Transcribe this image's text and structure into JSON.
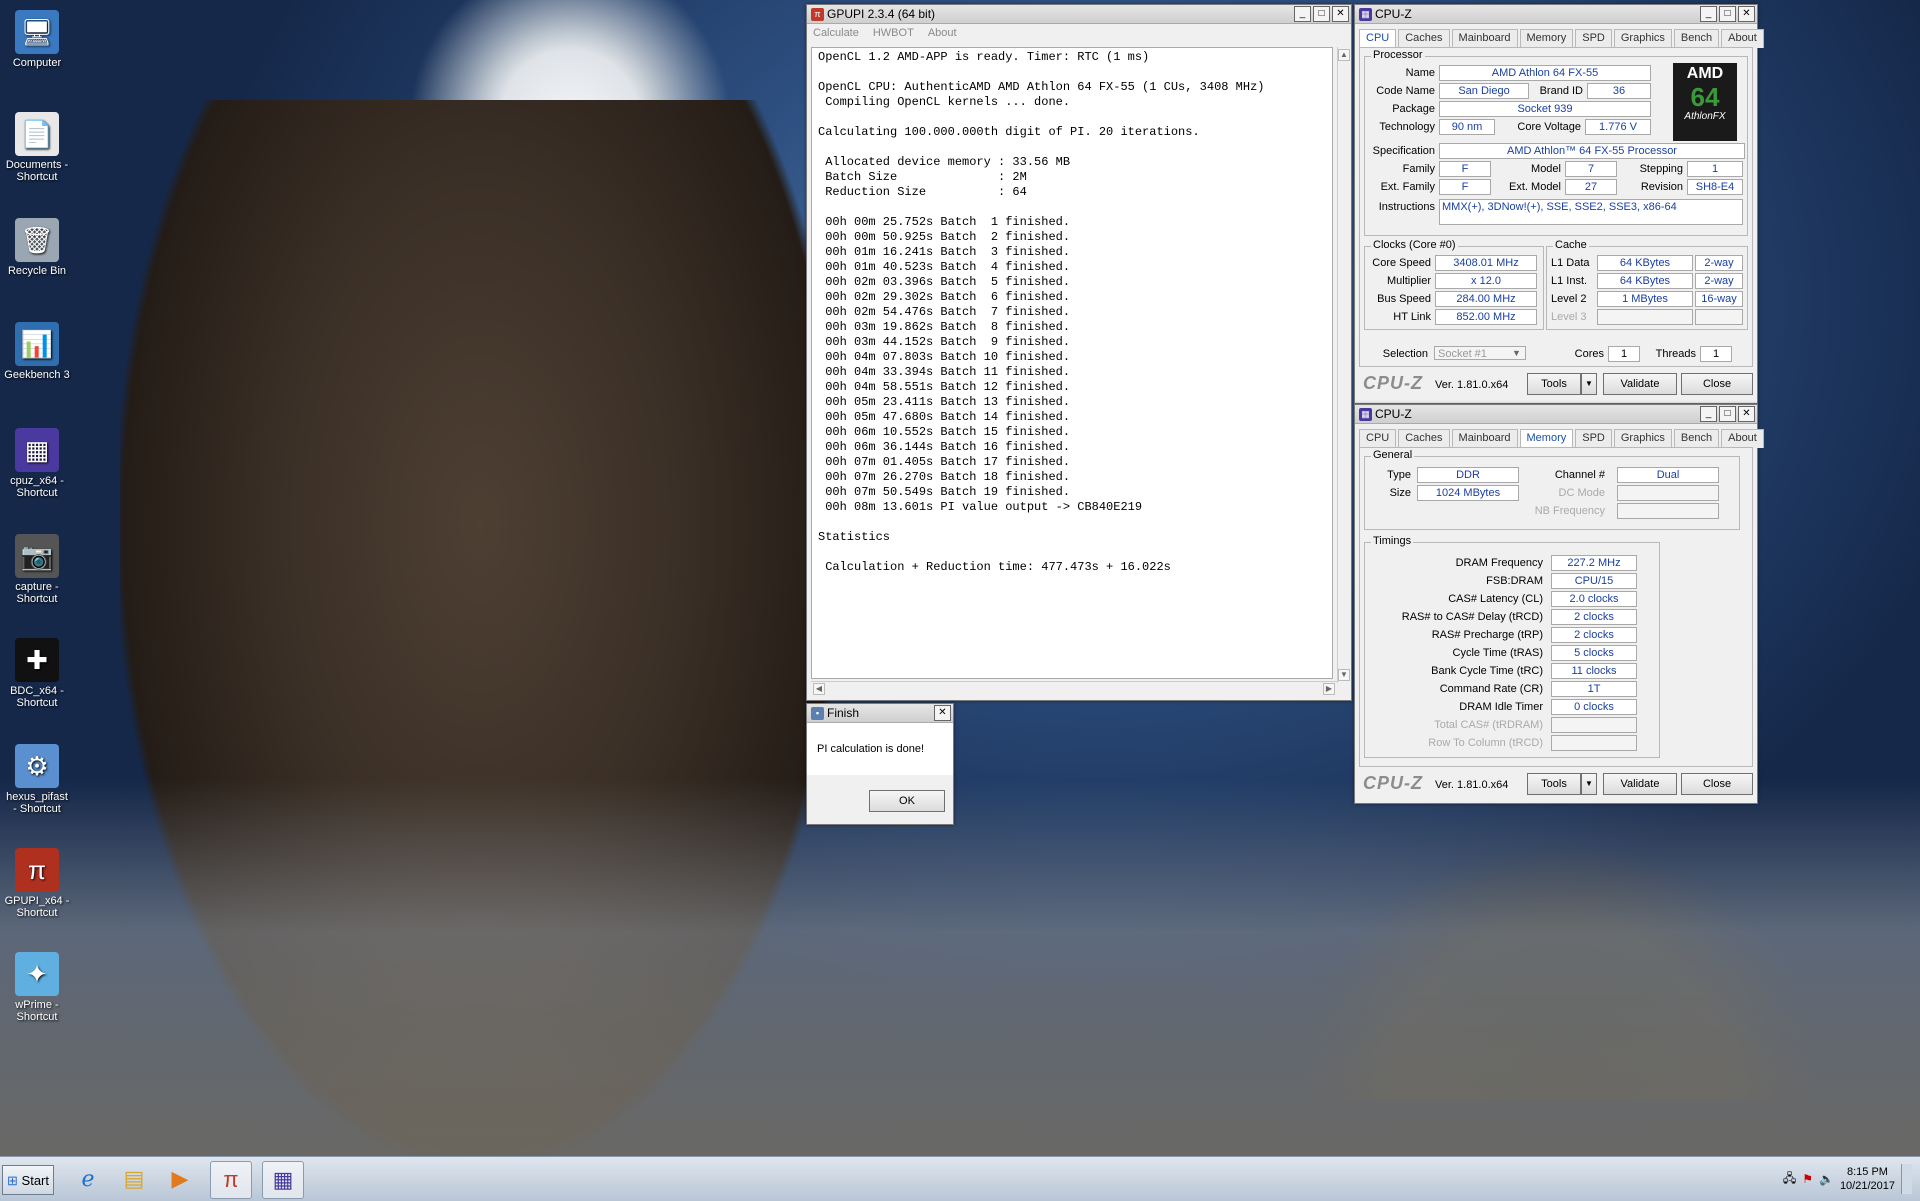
{
  "desktop_icons": [
    {
      "label": "Computer",
      "icon": "computer-icon",
      "glyph": "🖥"
    },
    {
      "label": "Documents - Shortcut",
      "icon": "documents-icon",
      "glyph": "📄"
    },
    {
      "label": "Recycle Bin",
      "icon": "recycle-bin-icon",
      "glyph": "🗑"
    },
    {
      "label": "Geekbench 3",
      "icon": "geekbench-icon",
      "glyph": "📊"
    },
    {
      "label": "cpuz_x64 - Shortcut",
      "icon": "cpuz-icon",
      "glyph": "▦"
    },
    {
      "label": "capture - Shortcut",
      "icon": "capture-icon",
      "glyph": "📷"
    },
    {
      "label": "BDC_x64 - Shortcut",
      "icon": "bdc-icon",
      "glyph": "✚"
    },
    {
      "label": "hexus_pifast - Shortcut",
      "icon": "pifast-icon",
      "glyph": "⚙"
    },
    {
      "label": "GPUPI_x64 - Shortcut",
      "icon": "gpupi-icon",
      "glyph": "π"
    },
    {
      "label": "wPrime - Shortcut",
      "icon": "wprime-icon",
      "glyph": "✦"
    }
  ],
  "gpupi": {
    "title": "GPUPI 2.3.4 (64 bit)",
    "menu": [
      "Calculate",
      "HWBOT",
      "About"
    ],
    "lines": [
      "OpenCL 1.2 AMD-APP is ready. Timer: RTC (1 ms)",
      "",
      "OpenCL CPU: AuthenticAMD AMD Athlon 64 FX-55 (1 CUs, 3408 MHz)",
      " Compiling OpenCL kernels ... done.",
      "",
      "Calculating 100.000.000th digit of PI. 20 iterations.",
      "",
      " Allocated device memory : 33.56 MB",
      " Batch Size              : 2M",
      " Reduction Size          : 64",
      "",
      " 00h 00m 25.752s Batch  1 finished.",
      " 00h 00m 50.925s Batch  2 finished.",
      " 00h 01m 16.241s Batch  3 finished.",
      " 00h 01m 40.523s Batch  4 finished.",
      " 00h 02m 03.396s Batch  5 finished.",
      " 00h 02m 29.302s Batch  6 finished.",
      " 00h 02m 54.476s Batch  7 finished.",
      " 00h 03m 19.862s Batch  8 finished.",
      " 00h 03m 44.152s Batch  9 finished.",
      " 00h 04m 07.803s Batch 10 finished.",
      " 00h 04m 33.394s Batch 11 finished.",
      " 00h 04m 58.551s Batch 12 finished.",
      " 00h 05m 23.411s Batch 13 finished.",
      " 00h 05m 47.680s Batch 14 finished.",
      " 00h 06m 10.552s Batch 15 finished.",
      " 00h 06m 36.144s Batch 16 finished.",
      " 00h 07m 01.405s Batch 17 finished.",
      " 00h 07m 26.270s Batch 18 finished.",
      " 00h 07m 50.549s Batch 19 finished.",
      " 00h 08m 13.601s PI value output -> CB840E219",
      "",
      "Statistics",
      "",
      " Calculation + Reduction time: 477.473s + 16.022s"
    ]
  },
  "finish": {
    "title": "Finish",
    "message": "PI calculation is done!",
    "ok_label": "OK"
  },
  "cpuz_common": {
    "title": "CPU-Z",
    "tabs": [
      "CPU",
      "Caches",
      "Mainboard",
      "Memory",
      "SPD",
      "Graphics",
      "Bench",
      "About"
    ],
    "logo": "CPU-Z",
    "version": "Ver. 1.81.0.x64",
    "tools_label": "Tools",
    "validate_label": "Validate",
    "close_label": "Close"
  },
  "cpuz_cpu": {
    "active_tab": "CPU",
    "processor_group": "Processor",
    "name_label": "Name",
    "name": "AMD Athlon 64 FX-55",
    "codename_label": "Code Name",
    "codename": "San Diego",
    "brandid_label": "Brand ID",
    "brandid": "36",
    "package_label": "Package",
    "package": "Socket 939",
    "technology_label": "Technology",
    "technology": "90 nm",
    "voltage_label": "Core Voltage",
    "voltage": "1.776 V",
    "spec_label": "Specification",
    "spec": "AMD Athlon™ 64 FX-55 Processor",
    "family_label": "Family",
    "family": "F",
    "model_label": "Model",
    "model": "7",
    "stepping_label": "Stepping",
    "stepping": "1",
    "extfamily_label": "Ext. Family",
    "extfamily": "F",
    "extmodel_label": "Ext. Model",
    "extmodel": "27",
    "revision_label": "Revision",
    "revision": "SH8-E4",
    "instructions_label": "Instructions",
    "instructions": "MMX(+), 3DNow!(+), SSE, SSE2, SSE3, x86-64",
    "logo_text_1": "AMD",
    "logo_text_2": "64",
    "logo_text_3": "AthlonFX",
    "clocks_group": "Clocks (Core #0)",
    "corespeed_label": "Core Speed",
    "corespeed": "3408.01 MHz",
    "multiplier_label": "Multiplier",
    "multiplier": "x 12.0",
    "busspeed_label": "Bus Speed",
    "busspeed": "284.00 MHz",
    "htlink_label": "HT Link",
    "htlink": "852.00 MHz",
    "cache_group": "Cache",
    "l1data_label": "L1 Data",
    "l1data": "64 KBytes",
    "l1data_way": "2-way",
    "l1inst_label": "L1 Inst.",
    "l1inst": "64 KBytes",
    "l1inst_way": "2-way",
    "level2_label": "Level 2",
    "level2": "1 MBytes",
    "level2_way": "16-way",
    "level3_label": "Level 3",
    "selection_label": "Selection",
    "selection": "Socket #1",
    "cores_label": "Cores",
    "cores": "1",
    "threads_label": "Threads",
    "threads": "1"
  },
  "cpuz_mem": {
    "active_tab": "Memory",
    "general_group": "General",
    "type_label": "Type",
    "type": "DDR",
    "size_label": "Size",
    "size": "1024 MBytes",
    "channel_label": "Channel #",
    "channel": "Dual",
    "dcmode_label": "DC Mode",
    "nbfreq_label": "NB Frequency",
    "timings_group": "Timings",
    "timings": [
      {
        "label": "DRAM Frequency",
        "value": "227.2 MHz"
      },
      {
        "label": "FSB:DRAM",
        "value": "CPU/15"
      },
      {
        "label": "CAS# Latency (CL)",
        "value": "2.0 clocks"
      },
      {
        "label": "RAS# to CAS# Delay (tRCD)",
        "value": "2 clocks"
      },
      {
        "label": "RAS# Precharge (tRP)",
        "value": "2 clocks"
      },
      {
        "label": "Cycle Time (tRAS)",
        "value": "5 clocks"
      },
      {
        "label": "Bank Cycle Time (tRC)",
        "value": "11 clocks"
      },
      {
        "label": "Command Rate (CR)",
        "value": "1T"
      },
      {
        "label": "DRAM Idle Timer",
        "value": "0 clocks"
      },
      {
        "label": "Total CAS# (tRDRAM)",
        "value": ""
      },
      {
        "label": "Row To Column (tRCD)",
        "value": ""
      }
    ]
  },
  "taskbar": {
    "start_label": "Start",
    "time": "8:15 PM",
    "date": "10/21/2017"
  }
}
